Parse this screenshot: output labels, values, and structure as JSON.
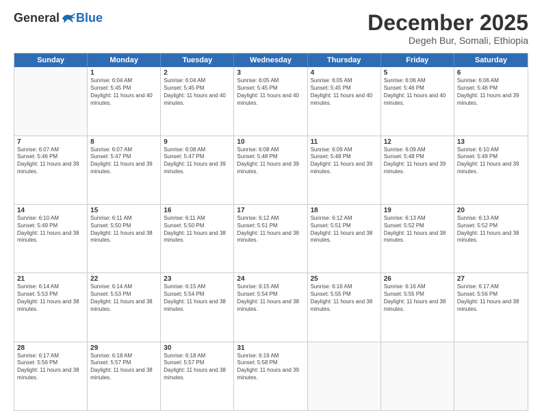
{
  "header": {
    "logo_general": "General",
    "logo_blue": "Blue",
    "month_title": "December 2025",
    "subtitle": "Degeh Bur, Somali, Ethiopia"
  },
  "days_of_week": [
    "Sunday",
    "Monday",
    "Tuesday",
    "Wednesday",
    "Thursday",
    "Friday",
    "Saturday"
  ],
  "weeks": [
    [
      {
        "day": "",
        "empty": true
      },
      {
        "day": "1",
        "sunrise": "Sunrise: 6:04 AM",
        "sunset": "Sunset: 5:45 PM",
        "daylight": "Daylight: 11 hours and 40 minutes."
      },
      {
        "day": "2",
        "sunrise": "Sunrise: 6:04 AM",
        "sunset": "Sunset: 5:45 PM",
        "daylight": "Daylight: 11 hours and 40 minutes."
      },
      {
        "day": "3",
        "sunrise": "Sunrise: 6:05 AM",
        "sunset": "Sunset: 5:45 PM",
        "daylight": "Daylight: 11 hours and 40 minutes."
      },
      {
        "day": "4",
        "sunrise": "Sunrise: 6:05 AM",
        "sunset": "Sunset: 5:45 PM",
        "daylight": "Daylight: 11 hours and 40 minutes."
      },
      {
        "day": "5",
        "sunrise": "Sunrise: 6:06 AM",
        "sunset": "Sunset: 5:46 PM",
        "daylight": "Daylight: 11 hours and 40 minutes."
      },
      {
        "day": "6",
        "sunrise": "Sunrise: 6:06 AM",
        "sunset": "Sunset: 5:46 PM",
        "daylight": "Daylight: 11 hours and 39 minutes."
      }
    ],
    [
      {
        "day": "7",
        "sunrise": "Sunrise: 6:07 AM",
        "sunset": "Sunset: 5:46 PM",
        "daylight": "Daylight: 11 hours and 39 minutes."
      },
      {
        "day": "8",
        "sunrise": "Sunrise: 6:07 AM",
        "sunset": "Sunset: 5:47 PM",
        "daylight": "Daylight: 11 hours and 39 minutes."
      },
      {
        "day": "9",
        "sunrise": "Sunrise: 6:08 AM",
        "sunset": "Sunset: 5:47 PM",
        "daylight": "Daylight: 11 hours and 39 minutes."
      },
      {
        "day": "10",
        "sunrise": "Sunrise: 6:08 AM",
        "sunset": "Sunset: 5:48 PM",
        "daylight": "Daylight: 11 hours and 39 minutes."
      },
      {
        "day": "11",
        "sunrise": "Sunrise: 6:09 AM",
        "sunset": "Sunset: 5:48 PM",
        "daylight": "Daylight: 11 hours and 39 minutes."
      },
      {
        "day": "12",
        "sunrise": "Sunrise: 6:09 AM",
        "sunset": "Sunset: 5:48 PM",
        "daylight": "Daylight: 11 hours and 39 minutes."
      },
      {
        "day": "13",
        "sunrise": "Sunrise: 6:10 AM",
        "sunset": "Sunset: 5:49 PM",
        "daylight": "Daylight: 11 hours and 39 minutes."
      }
    ],
    [
      {
        "day": "14",
        "sunrise": "Sunrise: 6:10 AM",
        "sunset": "Sunset: 5:49 PM",
        "daylight": "Daylight: 11 hours and 38 minutes."
      },
      {
        "day": "15",
        "sunrise": "Sunrise: 6:11 AM",
        "sunset": "Sunset: 5:50 PM",
        "daylight": "Daylight: 11 hours and 38 minutes."
      },
      {
        "day": "16",
        "sunrise": "Sunrise: 6:11 AM",
        "sunset": "Sunset: 5:50 PM",
        "daylight": "Daylight: 11 hours and 38 minutes."
      },
      {
        "day": "17",
        "sunrise": "Sunrise: 6:12 AM",
        "sunset": "Sunset: 5:51 PM",
        "daylight": "Daylight: 11 hours and 38 minutes."
      },
      {
        "day": "18",
        "sunrise": "Sunrise: 6:12 AM",
        "sunset": "Sunset: 5:51 PM",
        "daylight": "Daylight: 11 hours and 38 minutes."
      },
      {
        "day": "19",
        "sunrise": "Sunrise: 6:13 AM",
        "sunset": "Sunset: 5:52 PM",
        "daylight": "Daylight: 11 hours and 38 minutes."
      },
      {
        "day": "20",
        "sunrise": "Sunrise: 6:13 AM",
        "sunset": "Sunset: 5:52 PM",
        "daylight": "Daylight: 11 hours and 38 minutes."
      }
    ],
    [
      {
        "day": "21",
        "sunrise": "Sunrise: 6:14 AM",
        "sunset": "Sunset: 5:53 PM",
        "daylight": "Daylight: 11 hours and 38 minutes."
      },
      {
        "day": "22",
        "sunrise": "Sunrise: 6:14 AM",
        "sunset": "Sunset: 5:53 PM",
        "daylight": "Daylight: 11 hours and 38 minutes."
      },
      {
        "day": "23",
        "sunrise": "Sunrise: 6:15 AM",
        "sunset": "Sunset: 5:54 PM",
        "daylight": "Daylight: 11 hours and 38 minutes."
      },
      {
        "day": "24",
        "sunrise": "Sunrise: 6:15 AM",
        "sunset": "Sunset: 5:54 PM",
        "daylight": "Daylight: 11 hours and 38 minutes."
      },
      {
        "day": "25",
        "sunrise": "Sunrise: 6:16 AM",
        "sunset": "Sunset: 5:55 PM",
        "daylight": "Daylight: 11 hours and 38 minutes."
      },
      {
        "day": "26",
        "sunrise": "Sunrise: 6:16 AM",
        "sunset": "Sunset: 5:55 PM",
        "daylight": "Daylight: 11 hours and 38 minutes."
      },
      {
        "day": "27",
        "sunrise": "Sunrise: 6:17 AM",
        "sunset": "Sunset: 5:56 PM",
        "daylight": "Daylight: 11 hours and 38 minutes."
      }
    ],
    [
      {
        "day": "28",
        "sunrise": "Sunrise: 6:17 AM",
        "sunset": "Sunset: 5:56 PM",
        "daylight": "Daylight: 11 hours and 38 minutes."
      },
      {
        "day": "29",
        "sunrise": "Sunrise: 6:18 AM",
        "sunset": "Sunset: 5:57 PM",
        "daylight": "Daylight: 11 hours and 38 minutes."
      },
      {
        "day": "30",
        "sunrise": "Sunrise: 6:18 AM",
        "sunset": "Sunset: 5:57 PM",
        "daylight": "Daylight: 11 hours and 38 minutes."
      },
      {
        "day": "31",
        "sunrise": "Sunrise: 6:19 AM",
        "sunset": "Sunset: 5:58 PM",
        "daylight": "Daylight: 11 hours and 39 minutes."
      },
      {
        "day": "",
        "empty": true
      },
      {
        "day": "",
        "empty": true
      },
      {
        "day": "",
        "empty": true
      }
    ]
  ]
}
